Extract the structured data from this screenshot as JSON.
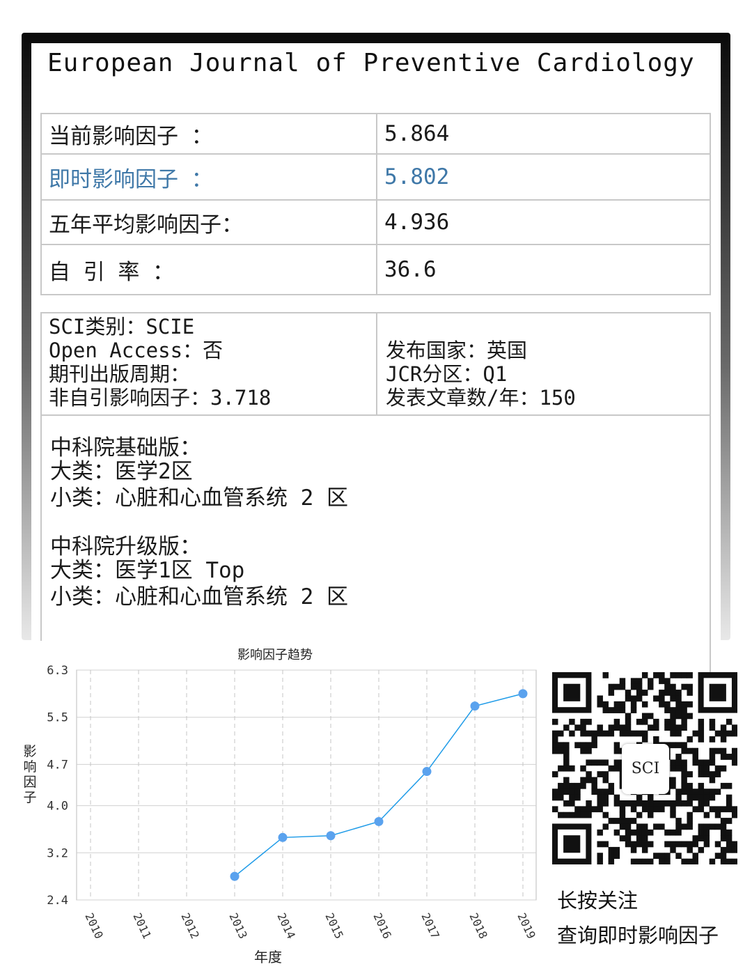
{
  "journal": {
    "title": "European Journal of Preventive Cardiology"
  },
  "metrics": [
    {
      "label": "当前影响因子 ：",
      "value": "5.864",
      "highlight": false
    },
    {
      "label": "即时影响因子 ：",
      "value": "5.802",
      "highlight": true
    },
    {
      "label": "五年平均影响因子：",
      "value": "4.936",
      "highlight": false
    },
    {
      "label": "自 引 率 ：",
      "value": "36.6",
      "highlight": false
    }
  ],
  "sci_info": {
    "category": "SCI类别：SCIE",
    "open_access": "Open Access：否",
    "cycle": "期刊出版周期：",
    "non_self_if": "非自引影响因子：3.718",
    "country": "发布国家：英国",
    "jcr": "JCR分区：Q1",
    "articles": "发表文章数/年：150"
  },
  "cas": {
    "basic": {
      "title": "中科院基础版：",
      "major": "大类：医学2区",
      "minor": "小类：心脏和心血管系统 2 区"
    },
    "upgrade": {
      "title": "中科院升级版：",
      "major": "大类：医学1区 Top",
      "minor": "小类：心脏和心血管系统 2 区"
    }
  },
  "chart_data": {
    "type": "line",
    "title": "影响因子趋势",
    "xlabel": "年度",
    "ylabel": "影响因子",
    "categories": [
      "2010",
      "2011",
      "2012",
      "2013",
      "2014",
      "2015",
      "2016",
      "2017",
      "2018",
      "2019"
    ],
    "series": [
      {
        "values": [
          null,
          null,
          null,
          2.8,
          3.46,
          3.49,
          3.73,
          4.58,
          5.69,
          5.9
        ]
      }
    ],
    "ylim": [
      2.4,
      6.3
    ],
    "yticks": [
      "6.3",
      "5.5",
      "4.7",
      "4.0",
      "3.2",
      "2.4"
    ],
    "grid": true,
    "color": "#1e9be8",
    "marker_color": "#5aa2ee"
  },
  "qr": {
    "center_label": "SCI",
    "cta_line1": "长按关注",
    "cta_line2": "查询即时影响因子"
  }
}
